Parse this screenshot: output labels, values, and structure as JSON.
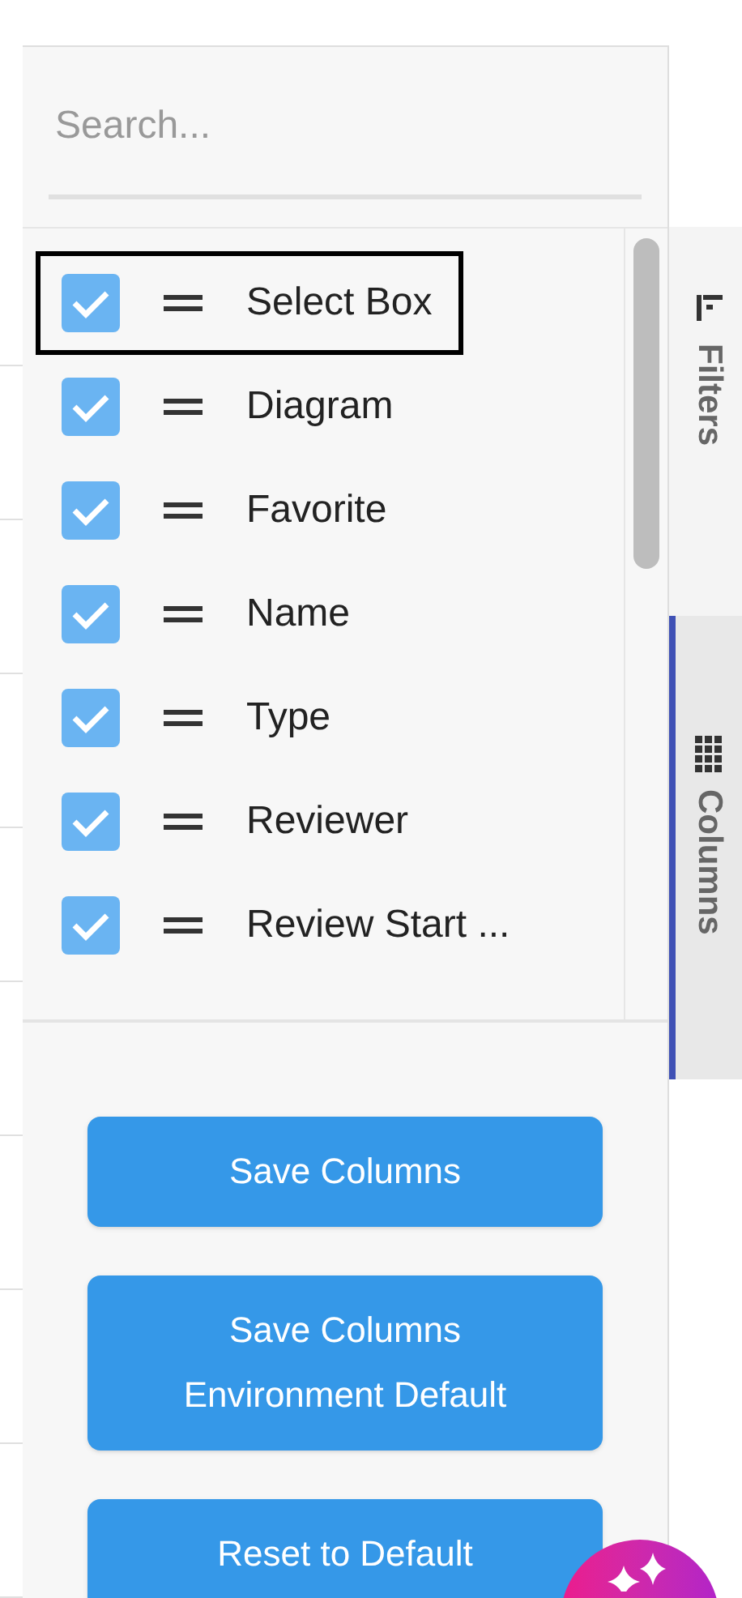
{
  "search": {
    "placeholder": "Search..."
  },
  "columns": [
    {
      "label": "Select Box",
      "checked": true,
      "focused": true
    },
    {
      "label": "Diagram",
      "checked": true,
      "focused": false
    },
    {
      "label": "Favorite",
      "checked": true,
      "focused": false
    },
    {
      "label": "Name",
      "checked": true,
      "focused": false
    },
    {
      "label": "Type",
      "checked": true,
      "focused": false
    },
    {
      "label": "Reviewer",
      "checked": true,
      "focused": false
    },
    {
      "label": "Review Start ...",
      "checked": true,
      "focused": false
    }
  ],
  "buttons": [
    {
      "label": "Save Columns"
    },
    {
      "label": "Save Columns Environment Default"
    },
    {
      "label": "Reset to Default"
    }
  ],
  "side_tabs": [
    {
      "kind": "filters",
      "label": "Filters",
      "selected": false
    },
    {
      "kind": "columns",
      "label": "Columns",
      "selected": true
    }
  ]
}
